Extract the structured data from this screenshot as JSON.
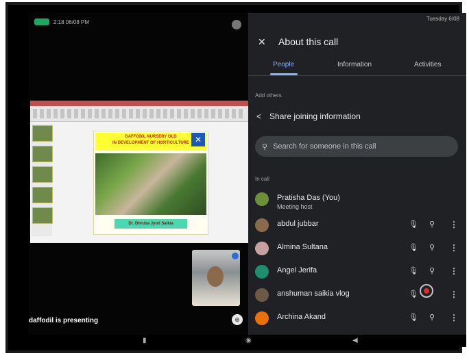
{
  "status": {
    "left_time": "2:18 06/08 PM",
    "right_time": "Tuesday 6/08"
  },
  "slide": {
    "title_line1": "DAFFODIL NURSERY OLD",
    "title_line2": "IN DEVELOPMENT OF HORTICULTURE",
    "footer": "Dr. Dhruba Jyoti Saikia"
  },
  "stage": {
    "presenting": "daffodil is presenting"
  },
  "panel": {
    "title": "About this call",
    "tabs": [
      "People",
      "Information",
      "Activities"
    ],
    "add_others": "Add others",
    "share": "Share joining information",
    "search_placeholder": "Search for someone in this call",
    "in_call": "In call",
    "people": [
      {
        "name": "Pratisha Das (You)",
        "sub": "Meeting host",
        "color": "#6d8f3a"
      },
      {
        "name": "abdul jubbar",
        "sub": "",
        "color": "#8a6a4a"
      },
      {
        "name": "Almina Sultana",
        "sub": "",
        "color": "#c9a0a0"
      },
      {
        "name": "Angel Jerifa",
        "sub": "",
        "color": "#1e8e6e"
      },
      {
        "name": "anshuman saikia vlog",
        "sub": "",
        "color": "#6b5a46"
      },
      {
        "name": "Archina Akand",
        "sub": "",
        "color": "#e8710a"
      }
    ]
  },
  "colors": {
    "panel_bg": "#202124",
    "accent": "#8ab4f8",
    "cam_green": "#1fa463"
  }
}
